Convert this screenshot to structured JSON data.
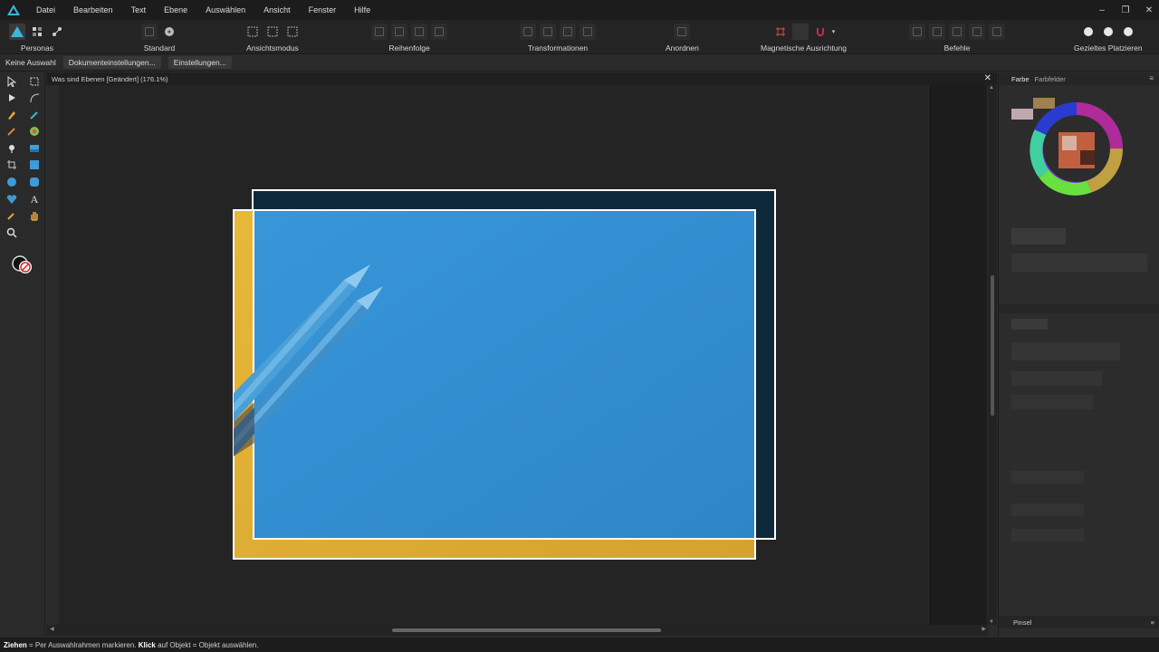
{
  "menu": [
    "Datei",
    "Bearbeiten",
    "Text",
    "Ebene",
    "Auswählen",
    "Ansicht",
    "Fenster",
    "Hilfe"
  ],
  "toolbar": {
    "personas": "Personas",
    "standard": "Standard",
    "ansichtsmodus": "Ansichtsmodus",
    "reihenfolge": "Reihenfolge",
    "transformationen": "Transformationen",
    "anordnen": "Anordnen",
    "magnetische": "Magnetische Ausrichtung",
    "befehle": "Befehle",
    "gezieltes": "Gezieltes Platzieren"
  },
  "context": {
    "selection": "Keine Auswahl",
    "doc_settings": "Dokumenteinstellungen...",
    "settings": "Einstellungen..."
  },
  "document": {
    "title": "Was sind Ebenen [Geändert] (176.1%)"
  },
  "right_panel": {
    "tab_color": "Farbe",
    "tab_swatches": "Farbfelder",
    "bottom_tab": "Pinsel"
  },
  "status": {
    "drag": "Ziehen",
    "drag_text": " = Per Auswahlrahmen markieren. ",
    "click": "Klick",
    "click_text": " auf Objekt = Objekt auswählen."
  },
  "colors": {
    "accent": "#3fb6d8",
    "yellow": "#e2b132",
    "blue": "#2f8fd3",
    "dark": "#0e2a3a"
  }
}
